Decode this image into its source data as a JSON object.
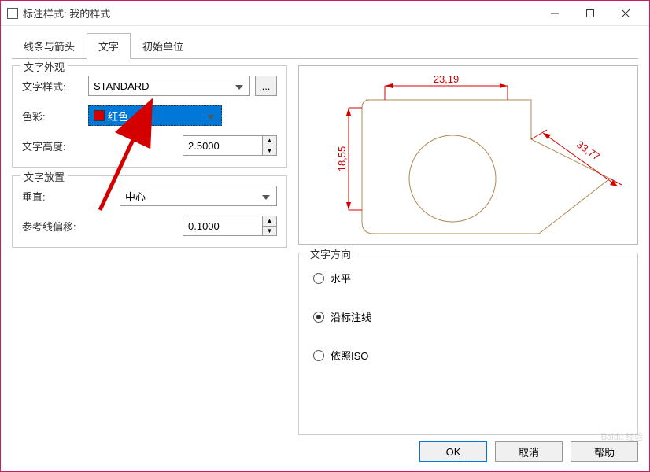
{
  "window": {
    "title": "标注样式: 我的样式"
  },
  "tabs": {
    "items": [
      {
        "label": "线条与箭头"
      },
      {
        "label": "文字"
      },
      {
        "label": "初始单位"
      }
    ]
  },
  "appearance": {
    "group_label": "文字外观",
    "style_label": "文字样式:",
    "style_value": "STANDARD",
    "style_button": "...",
    "color_label": "色彩:",
    "color_value": "红色",
    "height_label": "文字高度:",
    "height_value": "2.5000"
  },
  "placement": {
    "group_label": "文字放置",
    "vertical_label": "垂直:",
    "vertical_value": "中心",
    "offset_label": "参考线偏移:",
    "offset_value": "0.1000"
  },
  "preview": {
    "dim_h": "23,19",
    "dim_v": "18,55",
    "dim_diag": "33,77"
  },
  "direction": {
    "group_label": "文字方向",
    "options": [
      {
        "label": "水平"
      },
      {
        "label": "沿标注线"
      },
      {
        "label": "依照ISO"
      }
    ],
    "selected": 1
  },
  "footer": {
    "ok": "OK",
    "cancel": "取消",
    "help": "帮助"
  },
  "watermark": "Baidu 经验"
}
